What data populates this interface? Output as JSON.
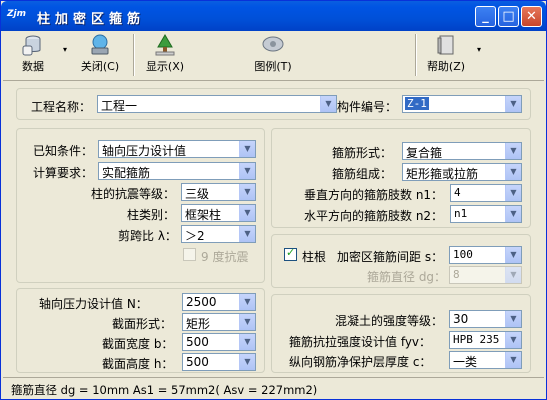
{
  "window": {
    "badge": "Zjm",
    "title": "柱加密区箍筋",
    "min_glyph": "_",
    "max_glyph": "□",
    "close_glyph": "✕"
  },
  "toolbar": {
    "data": "数据",
    "close": "关闭(C)",
    "show": "显示(X)",
    "legend": "图例(T)",
    "help": "帮助(Z)",
    "arrow": "▾"
  },
  "header": {
    "project_label": "工程名称：",
    "project_value": "工程一",
    "component_label": "构件编号：",
    "component_value": "Z-1"
  },
  "conditions": {
    "known_label": "已知条件：",
    "known_value": "轴向压力设计值",
    "calc_label": "计算要求：",
    "calc_value": "实配箍筋",
    "seismic_label": "柱的抗震等级：",
    "seismic_value": "三级",
    "type_label": "柱类别：",
    "type_value": "框架柱",
    "shear_label": "剪跨比 λ：",
    "shear_value": "＞2",
    "deg9_label": "9 度抗震"
  },
  "stirrup": {
    "form_label": "箍筋形式：",
    "form_value": "复合箍",
    "comp_label": "箍筋组成：",
    "comp_value": "矩形箍或拉筋",
    "n1_label": "垂直方向的箍筋肢数 n1：",
    "n1_value": "4",
    "n2_label": "水平方向的箍筋肢数 n2：",
    "n2_value": "n1"
  },
  "spacing": {
    "root_label": "柱根",
    "spacing_label": "加密区箍筋间距 s：",
    "spacing_value": "100",
    "dia_label": "箍筋直径 dg：",
    "dia_value": "8"
  },
  "section": {
    "n_label": "轴向压力设计值 N：",
    "n_value": "2500",
    "shape_label": "截面形式：",
    "shape_value": "矩形",
    "b_label": "截面宽度 b：",
    "b_value": "500",
    "h_label": "截面高度 h：",
    "h_value": "500"
  },
  "material": {
    "concrete_label": "混凝土的强度等级：",
    "concrete_value": "30",
    "fyv_label": "箍筋抗拉强度设计值 fyv：",
    "fyv_value": "HPB 235",
    "cover_label": "纵向钢筋净保护层厚度 c：",
    "cover_value": "一类"
  },
  "status": {
    "text": "箍筋直径 dg = 10mm   As1 = 57mm2( Asv = 227mm2)"
  }
}
